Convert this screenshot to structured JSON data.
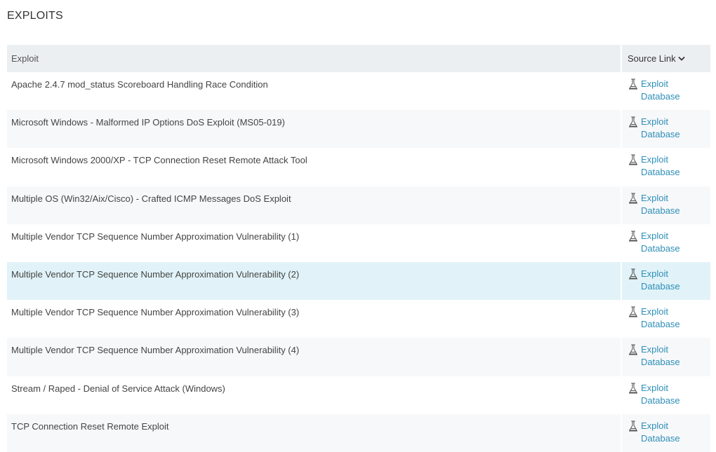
{
  "page": {
    "title": "EXPLOITS"
  },
  "table": {
    "columns": {
      "exploit": "Exploit",
      "source_link": "Source Link"
    },
    "sort_icon": "chevron-down-icon",
    "link_icon": "exploit-db-bug-icon",
    "accent_color": "#2f8fb8",
    "selected_row_color": "#e1f3f8",
    "rows": [
      {
        "exploit": "Apache 2.4.7 mod_status Scoreboard Handling Race Condition",
        "source": "Exploit Database"
      },
      {
        "exploit": "Microsoft Windows - Malformed IP Options DoS Exploit (MS05-019)",
        "source": "Exploit Database"
      },
      {
        "exploit": "Microsoft Windows 2000/XP - TCP Connection Reset Remote Attack Tool",
        "source": "Exploit Database"
      },
      {
        "exploit": "Multiple OS (Win32/Aix/Cisco) - Crafted ICMP Messages DoS Exploit",
        "source": "Exploit Database"
      },
      {
        "exploit": "Multiple Vendor TCP Sequence Number Approximation Vulnerability (1)",
        "source": "Exploit Database"
      },
      {
        "exploit": "Multiple Vendor TCP Sequence Number Approximation Vulnerability (2)",
        "source": "Exploit Database"
      },
      {
        "exploit": "Multiple Vendor TCP Sequence Number Approximation Vulnerability (3)",
        "source": "Exploit Database"
      },
      {
        "exploit": "Multiple Vendor TCP Sequence Number Approximation Vulnerability (4)",
        "source": "Exploit Database"
      },
      {
        "exploit": "Stream / Raped - Denial of Service Attack (Windows)",
        "source": "Exploit Database"
      },
      {
        "exploit": "TCP Connection Reset Remote Exploit",
        "source": "Exploit Database"
      }
    ]
  }
}
